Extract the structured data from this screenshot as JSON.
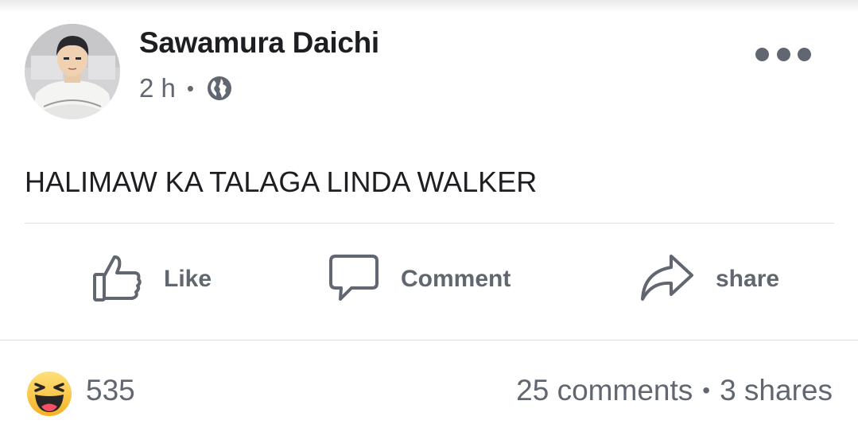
{
  "post": {
    "author": "Sawamura Daichi",
    "time": "2 h",
    "separator": "•",
    "audience_icon": "globe-icon",
    "more_icon": "more-options-icon",
    "text": "HALIMAW KA TALAGA LINDA WALKER"
  },
  "actions": {
    "like_label": "Like",
    "comment_label": "Comment",
    "share_label": "share"
  },
  "engagement": {
    "reaction_icon": "haha-emoji-icon",
    "reaction_count": "535",
    "comments": "25 comments",
    "separator": "•",
    "shares": "3 shares"
  },
  "colors": {
    "text_primary": "#1c1e21",
    "text_secondary": "#606770",
    "divider": "#dddfe2",
    "haha_yellow": "#fbcb3f"
  }
}
